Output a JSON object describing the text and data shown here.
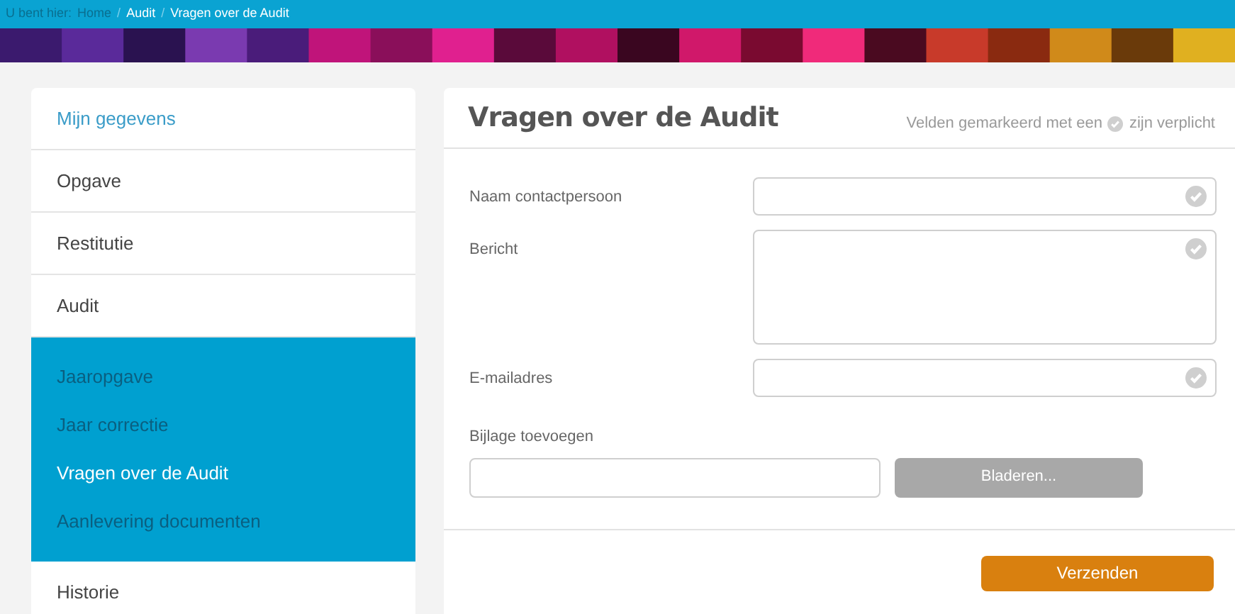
{
  "breadcrumb": {
    "prefix": "U bent hier:",
    "items": [
      {
        "label": "Home",
        "current": false
      },
      {
        "label": "Audit",
        "current": true
      },
      {
        "label": "Vragen over de Audit",
        "current": true
      }
    ],
    "separator": "/"
  },
  "sidebar": {
    "items": [
      {
        "label": "Mijn gegevens",
        "kind": "heading"
      },
      {
        "label": "Opgave",
        "kind": "item"
      },
      {
        "label": "Restitutie",
        "kind": "item"
      },
      {
        "label": "Audit",
        "kind": "item",
        "children": [
          {
            "label": "Jaaropgave",
            "selected": false
          },
          {
            "label": "Jaar correctie",
            "selected": false
          },
          {
            "label": "Vragen over de Audit",
            "selected": true
          },
          {
            "label": "Aanlevering documenten",
            "selected": false
          }
        ]
      },
      {
        "label": "Historie",
        "kind": "item"
      }
    ]
  },
  "form": {
    "title": "Vragen over de Audit",
    "required_note_before": "Velden gemarkeerd met een",
    "required_note_after": "zijn verplicht",
    "fields": [
      {
        "label": "Naam contactpersoon",
        "kind": "text",
        "required": true
      },
      {
        "label": "Bericht",
        "kind": "textarea",
        "required": true
      },
      {
        "label": "E-mailadres",
        "kind": "text",
        "required": true
      }
    ],
    "attachment": {
      "label": "Bijlage toevoegen",
      "browse_button": "Bladeren...",
      "disabled": true
    },
    "submit": "Verzenden"
  }
}
